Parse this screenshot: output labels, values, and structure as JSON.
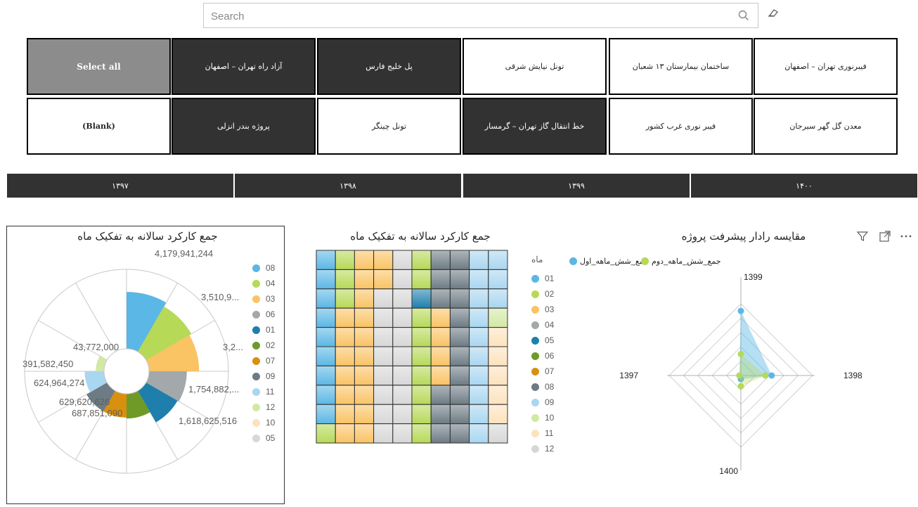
{
  "search": {
    "placeholder": "Search"
  },
  "slicer": {
    "row1": [
      {
        "label": "فیبرنوری تهران – اصفهان",
        "state": "off"
      },
      {
        "label": "ساختمان بیمارستان ۱۳ شعبان",
        "state": "off"
      },
      {
        "label": "تونل نیایش شرقی",
        "state": "off"
      },
      {
        "label": "پل خلیج فارس",
        "state": "on"
      },
      {
        "label": "آزاد راه تهران – اصفهان",
        "state": "on"
      },
      {
        "label": "Select all",
        "state": "grey"
      }
    ],
    "row2": [
      {
        "label": "معدن گل گهر سیرجان",
        "state": "off"
      },
      {
        "label": "فیبر نوری غرب کشور",
        "state": "off"
      },
      {
        "label": "خط انتقال گاز تهران – گرمسار",
        "state": "on"
      },
      {
        "label": "تونل چینگر",
        "state": "off"
      },
      {
        "label": "پروژه بندر انزلی",
        "state": "on"
      },
      {
        "label": "(Blank)",
        "state": "blank"
      }
    ]
  },
  "years": [
    "۱۳۹۷",
    "۱۳۹۸",
    "۱۳۹۹",
    "۱۴۰۰"
  ],
  "pie": {
    "title": "جمع کارکرد سالانه به تفکیک ماه",
    "labels": [
      "4,179,941,244",
      "3,510,9...",
      "3,2...",
      "1,754,882,...",
      "1,618,625,516",
      "687,851,090",
      "629,620,626",
      "624,964,274",
      "391,582,450",
      "43,772,000"
    ],
    "legend": [
      {
        "name": "08",
        "color": "#5bb7e5"
      },
      {
        "name": "04",
        "color": "#b6d957"
      },
      {
        "name": "03",
        "color": "#fac364"
      },
      {
        "name": "06",
        "color": "#a3a8ab"
      },
      {
        "name": "01",
        "color": "#1e7fad"
      },
      {
        "name": "02",
        "color": "#6f9a28"
      },
      {
        "name": "07",
        "color": "#d9900f"
      },
      {
        "name": "09",
        "color": "#6d7b84"
      },
      {
        "name": "11",
        "color": "#a9d6f0"
      },
      {
        "name": "12",
        "color": "#d2e8a5"
      },
      {
        "name": "10",
        "color": "#fde2bd"
      },
      {
        "name": "05",
        "color": "#d7d7d7"
      }
    ]
  },
  "heatmap": {
    "title": "جمع کارکرد سالانه به تفکیک ماه",
    "legend_title": "ماه",
    "legend": [
      {
        "name": "01",
        "color": "#5bb7e5"
      },
      {
        "name": "02",
        "color": "#b6d957"
      },
      {
        "name": "03",
        "color": "#fac364"
      },
      {
        "name": "04",
        "color": "#a3a8ab"
      },
      {
        "name": "05",
        "color": "#1e7fad"
      },
      {
        "name": "06",
        "color": "#6f9a28"
      },
      {
        "name": "07",
        "color": "#d9900f"
      },
      {
        "name": "08",
        "color": "#6d7b84"
      },
      {
        "name": "09",
        "color": "#a9d6f0"
      },
      {
        "name": "10",
        "color": "#d2e8a5"
      },
      {
        "name": "11",
        "color": "#fde2bd"
      },
      {
        "name": "12",
        "color": "#d7d7d7"
      }
    ]
  },
  "radar": {
    "title": "مقایسه رادار پیشرفت پروژه",
    "series_labels": [
      "جمع_شش_ماهه_اول",
      "جمع_شش_ماهه_دوم"
    ],
    "series_colors": [
      "#5bb7e5",
      "#b6d957"
    ],
    "axes": [
      "1399",
      "1398",
      "1400",
      "1397"
    ]
  },
  "chart_data": [
    {
      "type": "pie",
      "title": "جمع کارکرد سالانه به تفکیک ماه",
      "categories": [
        "08",
        "04",
        "03",
        "06",
        "01",
        "02",
        "07",
        "09",
        "11",
        "12",
        "10",
        "05"
      ],
      "values": [
        4179941244,
        3510900000,
        3200000000,
        1754882000,
        1618625516,
        687851090,
        629620626,
        624964274,
        391582450,
        43772000,
        0,
        0
      ]
    },
    {
      "type": "radar",
      "title": "مقایسه رادار پیشرفت پروژه",
      "categories": [
        "1399",
        "1398",
        "1400",
        "1397"
      ],
      "series": [
        {
          "name": "جمع_شش_ماهه_اول",
          "values": [
            0.9,
            0.43,
            0.05,
            0.02
          ]
        },
        {
          "name": "جمع_شش_ماهه_دوم",
          "values": [
            0.3,
            0.34,
            0.15,
            0.02
          ]
        }
      ]
    }
  ]
}
